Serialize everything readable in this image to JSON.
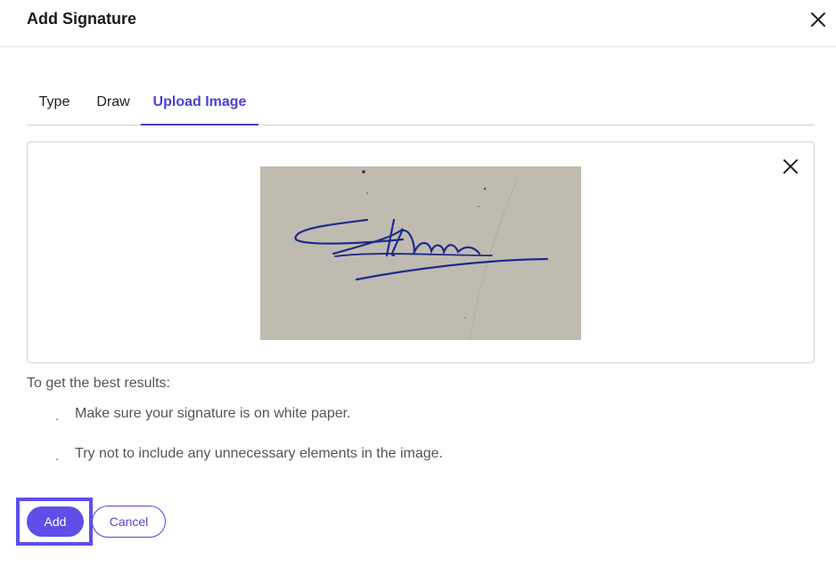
{
  "dialog": {
    "title": "Add Signature"
  },
  "tabs": [
    {
      "label": "Type"
    },
    {
      "label": "Draw"
    },
    {
      "label": "Upload Image",
      "active": true
    }
  ],
  "upload": {
    "image_icon": "signature-image",
    "remove_icon": "close-icon"
  },
  "tips": {
    "title": "To get the best results:",
    "items": [
      {
        "bullet": ".",
        "text": "Make sure your signature is on white paper."
      },
      {
        "bullet": ".",
        "text": "Try not to include any unnecessary elements in the image."
      }
    ]
  },
  "actions": {
    "add_label": "Add",
    "cancel_label": "Cancel"
  },
  "colors": {
    "accent": "#5d4fe8",
    "ink": "#1f2a8a",
    "paper": "#bdb8ad"
  }
}
